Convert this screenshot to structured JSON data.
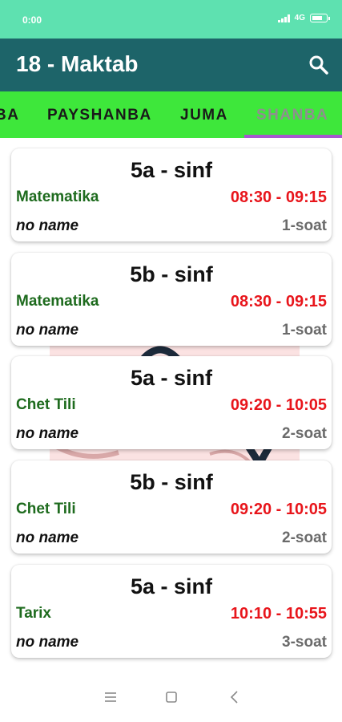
{
  "status": {
    "time": "0:00",
    "network": "4G"
  },
  "app": {
    "title": "18 - Maktab"
  },
  "icons": {
    "search": "search-icon",
    "menu": "menu-lines-icon",
    "home": "square-home-icon",
    "back": "back-chevron-icon"
  },
  "colors": {
    "statusbar": "#5ee1b0",
    "appbar": "#1d6469",
    "tabs": "#3ee73b",
    "indicator": "#a757cf",
    "subject": "#1e6b1e",
    "time": "#e8151b"
  },
  "tabs": [
    {
      "label": "BA"
    },
    {
      "label": "PAYSHANBA"
    },
    {
      "label": "JUMA"
    },
    {
      "label": "SHANBA"
    }
  ],
  "lessons": [
    {
      "class": "5a - sinf",
      "subject": "Matematika",
      "time": "08:30 - 09:15",
      "teacher": "no name",
      "lesson": "1-soat"
    },
    {
      "class": "5b - sinf",
      "subject": "Matematika",
      "time": "08:30 - 09:15",
      "teacher": "no name",
      "lesson": "1-soat"
    },
    {
      "class": "5a - sinf",
      "subject": "Chet Tili",
      "time": "09:20 - 10:05",
      "teacher": "no name",
      "lesson": "2-soat"
    },
    {
      "class": "5b - sinf",
      "subject": "Chet Tili",
      "time": "09:20 - 10:05",
      "teacher": "no name",
      "lesson": "2-soat"
    },
    {
      "class": "5a - sinf",
      "subject": "Tarix",
      "time": "10:10 - 10:55",
      "teacher": "no name",
      "lesson": "3-soat"
    }
  ]
}
